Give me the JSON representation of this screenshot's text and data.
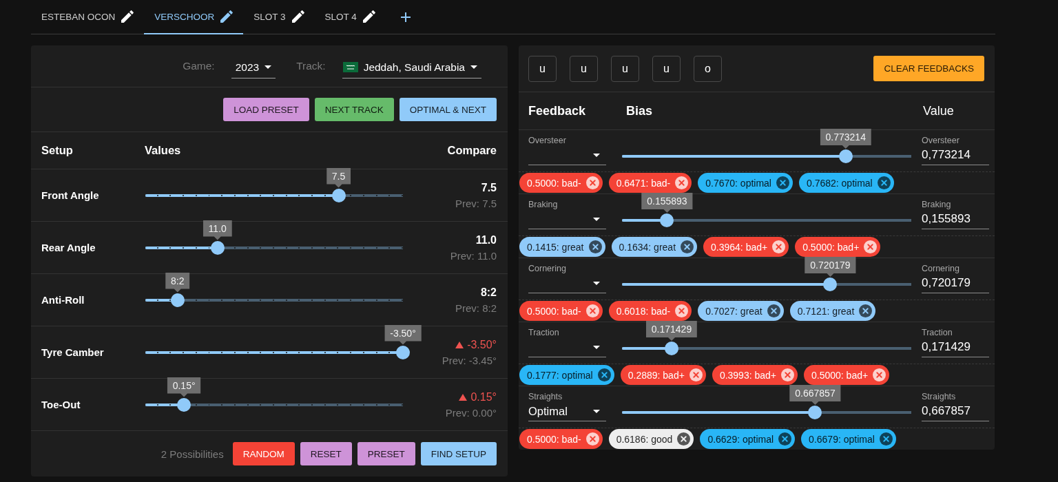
{
  "tabs": [
    {
      "label": "ESTEBAN OCON",
      "selected": false
    },
    {
      "label": "VERSCHOOR",
      "selected": true
    },
    {
      "label": "SLOT 3",
      "selected": false
    },
    {
      "label": "SLOT 4",
      "selected": false
    }
  ],
  "left_panel": {
    "game": {
      "label": "Game:",
      "value": "2023"
    },
    "track": {
      "label": "Track:",
      "value": "Jeddah, Saudi Arabia"
    },
    "actions": [
      {
        "label": "LOAD PRESET",
        "color": "#ce93d8"
      },
      {
        "label": "NEXT TRACK",
        "color": "#66bb6a"
      },
      {
        "label": "OPTIMAL & NEXT",
        "color": "#90caf9"
      }
    ],
    "columns": [
      "Setup",
      "Values",
      "Compare"
    ],
    "setup_rows": [
      {
        "label": "Front Angle",
        "tooltip": "7.5",
        "level": 0.75,
        "value": "7.5",
        "prev": "Prev: 7.5",
        "changed": false
      },
      {
        "label": "Rear Angle",
        "tooltip": "11.0",
        "level": 0.28,
        "value": "11.0",
        "prev": "Prev: 11.0",
        "changed": false
      },
      {
        "label": "Anti-Roll",
        "tooltip": "8:2",
        "level": 0.125,
        "value": "8:2",
        "prev": "Prev: 8:2",
        "changed": false
      },
      {
        "label": "Tyre Camber",
        "tooltip": "-3.50°",
        "level": 1,
        "value": "-3.50°",
        "prev": "Prev: -3.45°",
        "changed": true
      },
      {
        "label": "Toe-Out",
        "tooltip": "0.15°",
        "level": 0.15,
        "value": "0.15°",
        "prev": "Prev: 0.00°",
        "changed": true
      }
    ],
    "possibilities": "2 Possibilities",
    "footer_buttons": [
      {
        "label": "RANDOM",
        "color": "#f44336"
      },
      {
        "label": "RESET",
        "color": "#ce93d8"
      },
      {
        "label": "PRESET",
        "color": "#ce93d8"
      },
      {
        "label": "FIND SETUP",
        "color": "#90caf9"
      }
    ]
  },
  "right_panel": {
    "letter_buttons": [
      "u",
      "u",
      "u",
      "u",
      "o"
    ],
    "clear_button": {
      "label": "CLEAR FEEDBACKS",
      "color": "#ffa726"
    },
    "columns": [
      "Feedback",
      "Bias",
      "Value"
    ],
    "feedback_rows": [
      {
        "feedback_label": "Oversteer",
        "tooltip": "0.773214",
        "level": 0.773214,
        "value_label": "Oversteer",
        "value": "0,773214",
        "chips": [
          {
            "text": "0.5000: bad-",
            "color": "#f44336"
          },
          {
            "text": "0.6471: bad-",
            "color": "#f44336"
          },
          {
            "text": "0.7670: optimal",
            "color": "#29b6f6"
          },
          {
            "text": "0.7682: optimal",
            "color": "#29b6f6"
          }
        ]
      },
      {
        "feedback_label": "Braking",
        "tooltip": "0.155893",
        "level": 0.155893,
        "value_label": "Braking",
        "value": "0,155893",
        "chips": [
          {
            "text": "0.1415: great",
            "color": "#90caf9"
          },
          {
            "text": "0.1634: great",
            "color": "#90caf9"
          },
          {
            "text": "0.3964: bad+",
            "color": "#f44336"
          },
          {
            "text": "0.5000: bad+",
            "color": "#f44336"
          }
        ]
      },
      {
        "feedback_label": "Cornering",
        "tooltip": "0.720179",
        "level": 0.720179,
        "value_label": "Cornering",
        "value": "0,720179",
        "chips": [
          {
            "text": "0.5000: bad-",
            "color": "#f44336"
          },
          {
            "text": "0.6018: bad-",
            "color": "#f44336"
          },
          {
            "text": "0.7027: great",
            "color": "#90caf9"
          },
          {
            "text": "0.7121: great",
            "color": "#90caf9"
          }
        ]
      },
      {
        "feedback_label": "Traction",
        "tooltip": "0.171429",
        "level": 0.171429,
        "value_label": "Traction",
        "value": "0,171429",
        "chips": [
          {
            "text": "0.1777: optimal",
            "color": "#29b6f6"
          },
          {
            "text": "0.2889: bad+",
            "color": "#f44336"
          },
          {
            "text": "0.3993: bad+",
            "color": "#f44336"
          },
          {
            "text": "0.5000: bad+",
            "color": "#f44336"
          }
        ]
      },
      {
        "feedback_label": "Straights",
        "feedback": "Optimal",
        "tooltip": "0.667857",
        "level": 0.667857,
        "value_label": "Straights",
        "value": "0,667857",
        "chips": [
          {
            "text": "0.5000: bad-",
            "color": "#f44336"
          },
          {
            "text": "0.6186: good",
            "color": "#eeeeee"
          },
          {
            "text": "0.6629: optimal",
            "color": "#29b6f6"
          },
          {
            "text": "0.6679: optimal",
            "color": "#29b6f6"
          }
        ]
      }
    ]
  }
}
